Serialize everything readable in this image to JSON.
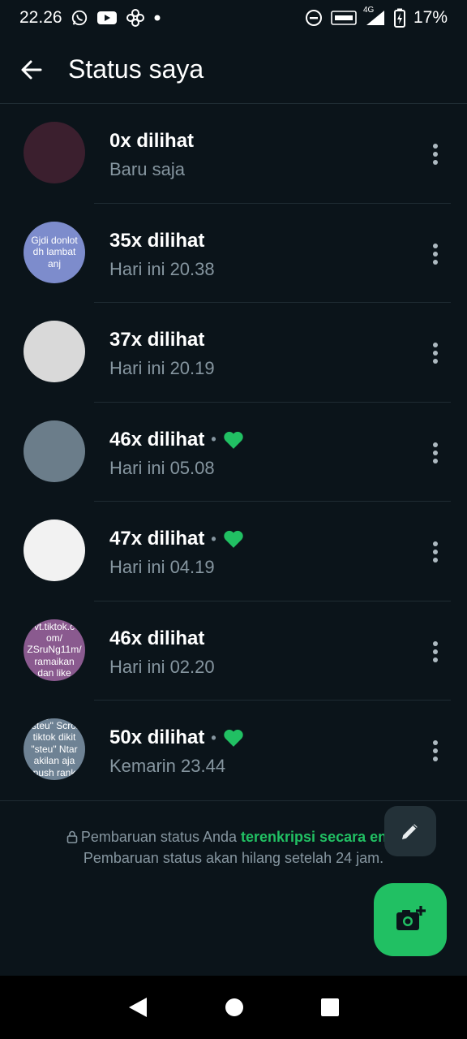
{
  "statusbar": {
    "time": "22.26",
    "network": "4G",
    "battery": "17%"
  },
  "header": {
    "title": "Status saya"
  },
  "items": [
    {
      "views": "0x dilihat",
      "time": "Baru saja",
      "liked": false,
      "thumb_text": "",
      "thumb_bg": "#3b1f2e"
    },
    {
      "views": "35x dilihat",
      "time": "Hari ini 20.38",
      "liked": false,
      "thumb_text": "Gjdi donlot dh lambat anj",
      "thumb_bg": "#7d8ccc"
    },
    {
      "views": "37x dilihat",
      "time": "Hari ini 20.19",
      "liked": false,
      "thumb_text": "",
      "thumb_bg": "#d9d9d9"
    },
    {
      "views": "46x dilihat",
      "time": "Hari ini 05.08",
      "liked": true,
      "thumb_text": "",
      "thumb_bg": "#6b7d8a"
    },
    {
      "views": "47x dilihat",
      "time": "Hari ini 04.19",
      "liked": true,
      "thumb_text": "",
      "thumb_bg": "#f2f2f2"
    },
    {
      "views": "46x dilihat",
      "time": "Hari ini 02.20",
      "liked": false,
      "thumb_text": "vt.tiktok.c om/ ZSruNg11m/ ramaikan dan like",
      "thumb_bg": "#8a5a8f"
    },
    {
      "views": "50x dilihat",
      "time": "Kemarin 23.44",
      "liked": true,
      "thumb_text": "Lengah dikit \"steu\" Scroll tiktok dikit \"steu\" Ntar akilan aja push rank \"steu\"",
      "thumb_bg": "#6e8294"
    }
  ],
  "footer": {
    "prefix": "Pembaruan status Anda ",
    "link": "terenkripsi secara end-",
    "line2": "Pembaruan status akan hilang setelah 24 jam."
  },
  "colors": {
    "accent": "#21c063",
    "background": "#0b141a",
    "secondary_text": "#8696a0"
  },
  "icons": {
    "back": "arrow-left-icon",
    "more": "more-vert-icon",
    "heart": "heart-icon",
    "edit": "pencil-icon",
    "camera": "camera-add-icon",
    "lock": "lock-icon"
  }
}
